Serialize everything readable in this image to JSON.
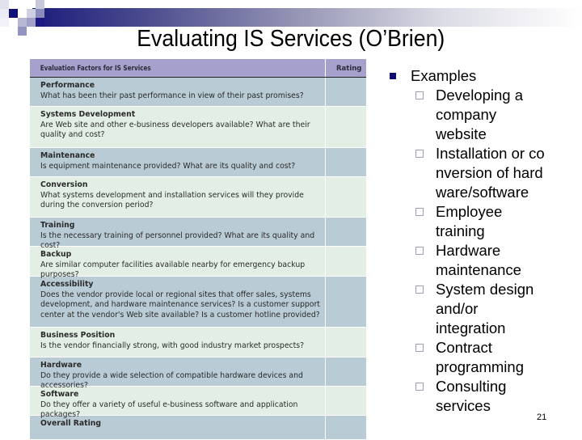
{
  "slide": {
    "title": "Evaluating IS Services (O’Brien)",
    "page_number": "21"
  },
  "colors": {
    "header_bg": "#a5a0cc",
    "row_dark": "#b9cbd5",
    "row_light": "#e3efe5",
    "bullet_primary": "#0d0d6e",
    "bullet_secondary": "#9d9db4"
  },
  "table": {
    "headers": [
      "Evaluation Factors for IS Services",
      "Rating"
    ],
    "rows": [
      {
        "factor": "Performance",
        "question": "What has been their past performance in view of their past promises?",
        "rating": ""
      },
      {
        "factor": "Systems Development",
        "question": "Are Web site and other e-business developers available? What are their quality and cost?",
        "rating": ""
      },
      {
        "factor": "Maintenance",
        "question": "Is equipment maintenance provided? What are its quality and cost?",
        "rating": ""
      },
      {
        "factor": "Conversion",
        "question": "What systems development and installation services will they provide during the conversion period?",
        "rating": ""
      },
      {
        "factor": "Training",
        "question": "Is the necessary training of personnel provided? What are its quality and cost?",
        "rating": ""
      },
      {
        "factor": "Backup",
        "question": "Are similar computer facilities available nearby for emergency backup purposes?",
        "rating": ""
      },
      {
        "factor": "Accessibility",
        "question": "Does the vendor provide local or regional sites that offer sales, systems development, and hardware maintenance services? Is a customer support center at the vendor's Web site available? Is a customer hotline provided?",
        "rating": ""
      },
      {
        "factor": "Business Position",
        "question": "Is the vendor financially strong, with good industry market prospects?",
        "rating": ""
      },
      {
        "factor": "Hardware",
        "question": "Do they provide a wide selection of compatible hardware devices and accessories?",
        "rating": ""
      },
      {
        "factor": "Software",
        "question": "Do they offer a variety of useful e-business software and application packages?",
        "rating": ""
      },
      {
        "factor": "Overall Rating",
        "question": "",
        "rating": ""
      }
    ]
  },
  "bullets": {
    "heading": "Examples",
    "items": [
      "Developing a company website",
      "Installation or conversion of hardware/software",
      "Employee training",
      "Hardware maintenance",
      "System design and/or integration",
      "Contract programming",
      "Consulting services"
    ]
  }
}
